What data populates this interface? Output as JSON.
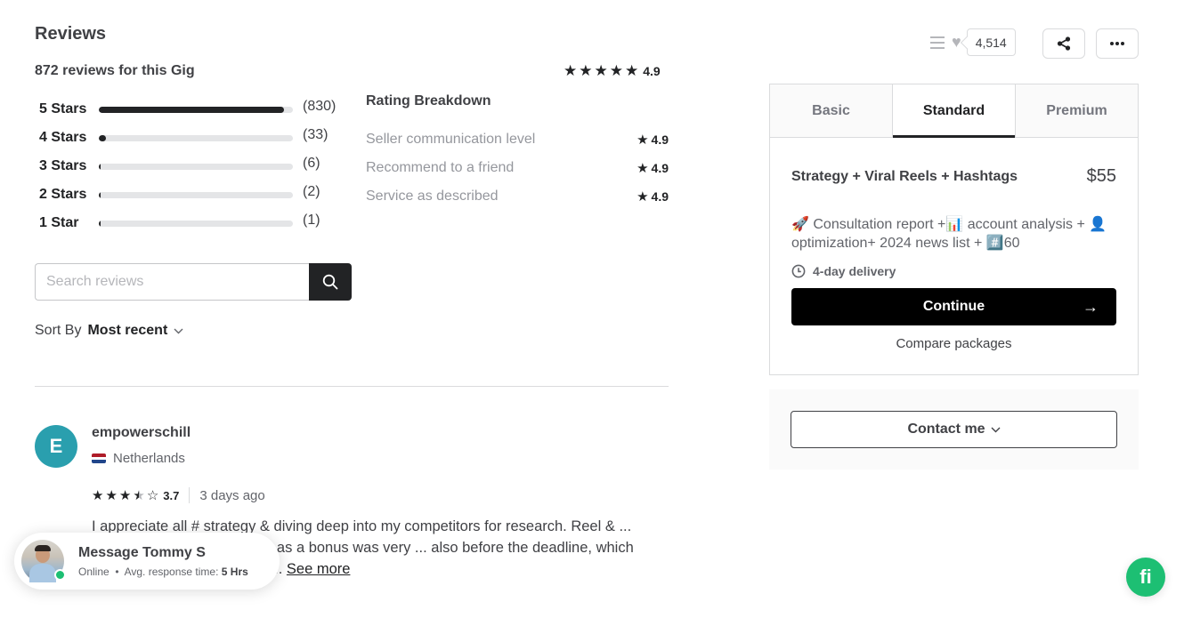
{
  "reviews": {
    "title": "Reviews",
    "count_text": "872 reviews for this Gig",
    "overall_rating": "4.9",
    "overall_stars": 5,
    "distribution": [
      {
        "label": "5 Stars",
        "count": "(830)",
        "fraction": 0.952
      },
      {
        "label": "4 Stars",
        "count": "(33)",
        "fraction": 0.038
      },
      {
        "label": "3 Stars",
        "count": "(6)",
        "fraction": 0.007
      },
      {
        "label": "2 Stars",
        "count": "(2)",
        "fraction": 0.002
      },
      {
        "label": "1 Star",
        "count": "(1)",
        "fraction": 0.001
      }
    ],
    "breakdown": {
      "title": "Rating Breakdown",
      "items": [
        {
          "label": "Seller communication level",
          "value": "4.9"
        },
        {
          "label": "Recommend to a friend",
          "value": "4.9"
        },
        {
          "label": "Service as described",
          "value": "4.9"
        }
      ]
    },
    "search": {
      "placeholder": "Search reviews",
      "value": ""
    },
    "sort": {
      "label": "Sort By",
      "value": "Most recent"
    },
    "items": [
      {
        "avatar_letter": "E",
        "avatar_color": "#2a9fae",
        "username": "empowerschill",
        "country": "Netherlands",
        "rating": "3.7",
        "rating_stars": 3.5,
        "time_ago": "3 days ago",
        "text": "I appreciate all # strategy & diving deep into my competitors for research. Reel & ... great, and the Thread guide as a bonus was very ... also before the deadline, which was exciting. Unfortunately,...",
        "see_more": "See more"
      }
    ]
  },
  "message_popup": {
    "title": "Message Tommy S",
    "status": "Online",
    "response_label": "Avg. response time:",
    "response_value": "5 Hrs"
  },
  "top_actions": {
    "like_count": "4,514",
    "share_icon": "share-icon",
    "more_icon": "more-icon"
  },
  "package": {
    "tabs": [
      {
        "label": "Basic",
        "active": false
      },
      {
        "label": "Standard",
        "active": true
      },
      {
        "label": "Premium",
        "active": false
      }
    ],
    "name": "Strategy + Viral Reels + Hashtags",
    "price": "$55",
    "description": "🚀 Consultation report +📊 account analysis + 👤optimization+ 2024 news list + #️⃣60",
    "delivery": "4-day delivery",
    "continue_label": "Continue",
    "compare_label": "Compare packages"
  },
  "contact": {
    "label": "Contact me"
  },
  "colors": {
    "accent": "#1dbf73",
    "dark": "#222325",
    "text": "#404145",
    "muted": "#95979d"
  }
}
